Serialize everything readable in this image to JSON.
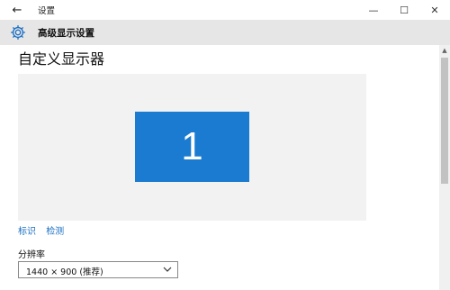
{
  "window": {
    "title": "设置",
    "back_icon": "←",
    "minimize_icon": "—",
    "maximize_icon": "☐",
    "close_icon": "✕"
  },
  "header": {
    "icon": "gear-icon",
    "title": "高级显示设置"
  },
  "page": {
    "title": "自定义显示器",
    "monitor_number": "1",
    "monitor_color": "#1a7bd0",
    "links": [
      "标识",
      "检测"
    ],
    "resolution_label": "分辨率",
    "resolution_value": "1440 × 900 (推荐)"
  },
  "colors": {
    "accent": "#1a7bd0",
    "link": "#1a6fc4",
    "header_bg": "#e6e6e6"
  }
}
